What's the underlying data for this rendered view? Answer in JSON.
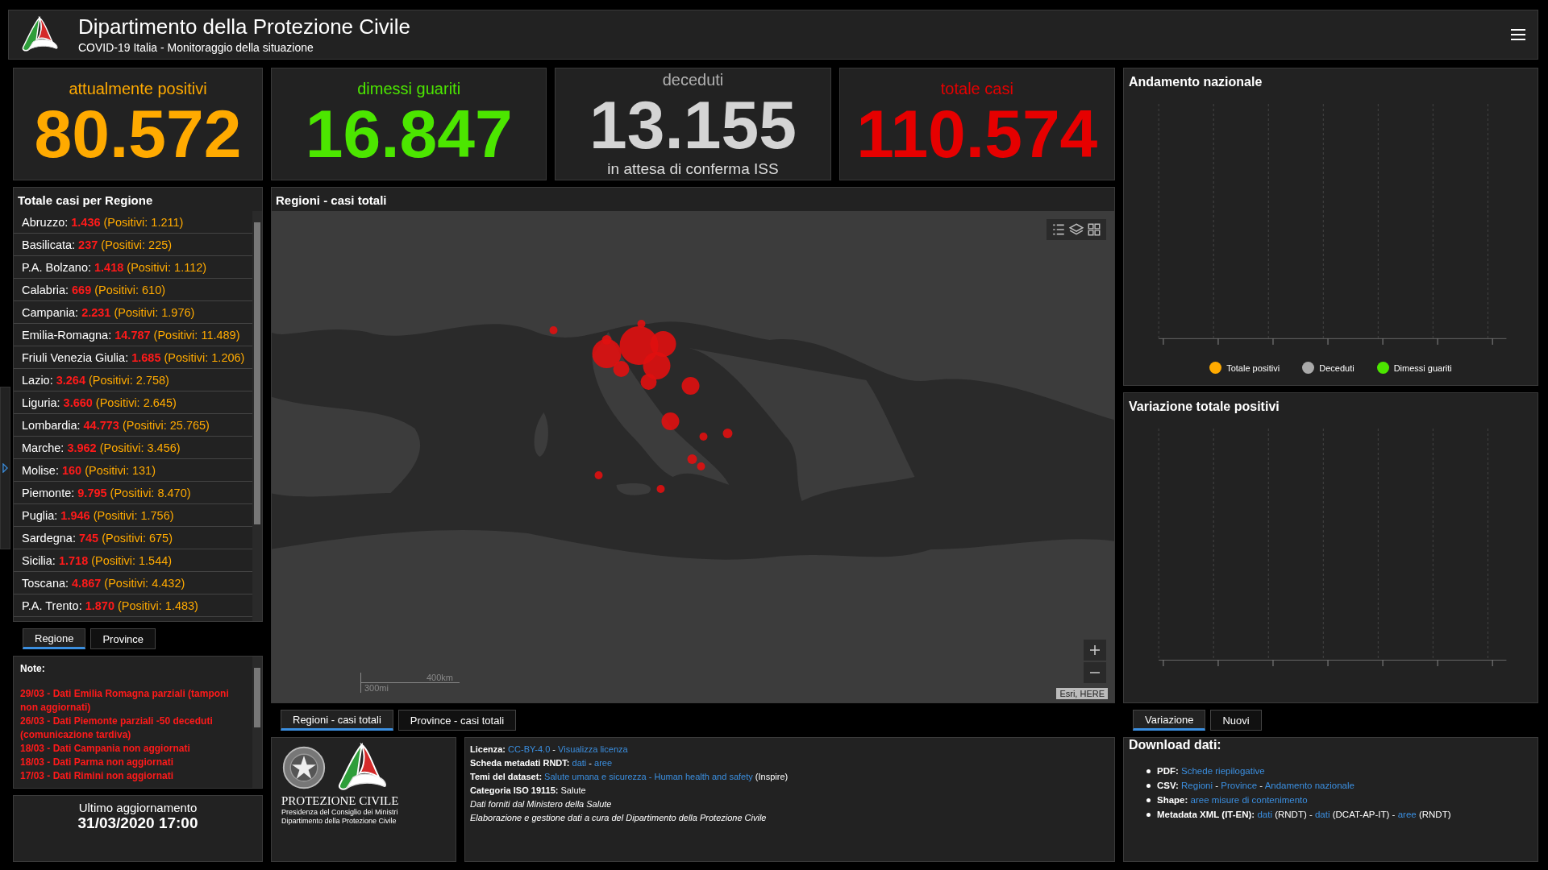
{
  "header": {
    "title": "Dipartimento della Protezione Civile",
    "subtitle": "COVID-19 Italia - Monitoraggio della situazione"
  },
  "kpis": [
    {
      "label": "attualmente positivi",
      "value": "80.572",
      "color": "#ffaa00"
    },
    {
      "label": "dimessi guariti",
      "value": "16.847",
      "color": "#4ce600"
    },
    {
      "label": "deceduti",
      "value": "13.155",
      "note": "in attesa di conferma ISS",
      "color": "#d4d4d4"
    },
    {
      "label": "totale casi",
      "value": "110.574",
      "color": "#e60000"
    }
  ],
  "regions_panel": {
    "title": "Totale casi per Regione",
    "rows": [
      {
        "name": "Abruzzo:",
        "total": "1.436",
        "positivi": "(Positivi: 1.211)"
      },
      {
        "name": "Basilicata:",
        "total": "237",
        "positivi": "(Positivi: 225)"
      },
      {
        "name": "P.A. Bolzano:",
        "total": "1.418",
        "positivi": "(Positivi: 1.112)"
      },
      {
        "name": "Calabria:",
        "total": "669",
        "positivi": "(Positivi: 610)"
      },
      {
        "name": "Campania:",
        "total": "2.231",
        "positivi": "(Positivi: 1.976)"
      },
      {
        "name": "Emilia-Romagna:",
        "total": "14.787",
        "positivi": "(Positivi: 11.489)"
      },
      {
        "name": "Friuli Venezia Giulia:",
        "total": "1.685",
        "positivi": "(Positivi: 1.206)"
      },
      {
        "name": "Lazio:",
        "total": "3.264",
        "positivi": "(Positivi: 2.758)"
      },
      {
        "name": "Liguria:",
        "total": "3.660",
        "positivi": "(Positivi: 2.645)"
      },
      {
        "name": "Lombardia:",
        "total": "44.773",
        "positivi": "(Positivi: 25.765)"
      },
      {
        "name": "Marche:",
        "total": "3.962",
        "positivi": "(Positivi: 3.456)"
      },
      {
        "name": "Molise:",
        "total": "160",
        "positivi": "(Positivi: 131)"
      },
      {
        "name": "Piemonte:",
        "total": "9.795",
        "positivi": "(Positivi: 8.470)"
      },
      {
        "name": "Puglia:",
        "total": "1.946",
        "positivi": "(Positivi: 1.756)"
      },
      {
        "name": "Sardegna:",
        "total": "745",
        "positivi": "(Positivi: 675)"
      },
      {
        "name": "Sicilia:",
        "total": "1.718",
        "positivi": "(Positivi: 1.544)"
      },
      {
        "name": "Toscana:",
        "total": "4.867",
        "positivi": "(Positivi: 4.432)"
      },
      {
        "name": "P.A. Trento:",
        "total": "1.870",
        "positivi": "(Positivi: 1.483)"
      }
    ]
  },
  "region_tabs": [
    {
      "label": "Regione",
      "selected": true
    },
    {
      "label": "Province",
      "selected": false
    }
  ],
  "notes": {
    "title": "Note:",
    "items": [
      "29/03 - Dati  Emilia Romagna parziali (tamponi non aggiornati)",
      "26/03 - Dati Piemonte parziali -50 deceduti (comunicazione tardiva)",
      "18/03 - Dati Campania non aggiornati",
      "18/03 - Dati Parma non aggiornati",
      "17/03 - Dati Rimini non aggiornati"
    ]
  },
  "last_update": {
    "label": "Ultimo aggiornamento",
    "value": "31/03/2020 17:00"
  },
  "map": {
    "title": "Regioni - casi totali",
    "scale_km": "400km",
    "scale_mi": "300mi",
    "attribution": "Esri, HERE",
    "tabs": [
      {
        "label": "Regioni - casi totali",
        "selected": true
      },
      {
        "label": "Province - casi totali",
        "selected": false
      }
    ]
  },
  "charts": [
    {
      "title": "Andamento nazionale",
      "legend": [
        {
          "label": "Totale positivi",
          "color": "#ffaa00"
        },
        {
          "label": "Deceduti",
          "color": "#aaaaaa"
        },
        {
          "label": "Dimessi guariti",
          "color": "#4ce600"
        }
      ]
    },
    {
      "title": "Variazione totale positivi"
    }
  ],
  "chart_tabs": [
    {
      "label": "Variazione",
      "selected": true
    },
    {
      "label": "Nuovi",
      "selected": false
    }
  ],
  "footer_logo": {
    "name": "PROTEZIONE CIVILE",
    "lines": [
      "Presidenza del Consiglio dei Ministri",
      "Dipartimento della Protezione Civile"
    ]
  },
  "info": [
    {
      "kind": "field",
      "parts": [
        {
          "kind": "label",
          "text": "Licenza:"
        },
        {
          "kind": "link",
          "text": "CC-BY-4.0"
        },
        {
          "kind": "text",
          "text": "-"
        },
        {
          "kind": "link",
          "text": "Visualizza licenza"
        }
      ]
    },
    {
      "kind": "field",
      "parts": [
        {
          "kind": "label",
          "text": "Scheda metadati RNDT:"
        },
        {
          "kind": "link",
          "text": "dati"
        },
        {
          "kind": "text",
          "text": "-"
        },
        {
          "kind": "link",
          "text": "aree"
        }
      ]
    },
    {
      "kind": "field",
      "parts": [
        {
          "kind": "label",
          "text": "Temi del dataset:"
        },
        {
          "kind": "link",
          "text": "Salute umana e sicurezza - Human health and safety"
        },
        {
          "kind": "text",
          "text": "(Inspire)"
        }
      ]
    },
    {
      "kind": "field",
      "parts": [
        {
          "kind": "label",
          "text": "Categoria ISO 19115:"
        },
        {
          "kind": "text",
          "text": "Salute"
        }
      ]
    },
    {
      "kind": "note",
      "parts": [
        {
          "kind": "text",
          "text": "Dati forniti dal Ministero della Salute"
        }
      ]
    },
    {
      "kind": "note",
      "parts": [
        {
          "kind": "text",
          "text": "Elaborazione e gestione dati a cura del Dipartimento della Protezione Civile"
        }
      ]
    }
  ],
  "downloads": {
    "title": "Download dati:",
    "items": [
      {
        "parts": [
          {
            "kind": "label",
            "text": "PDF:"
          },
          {
            "kind": "link",
            "text": "Schede riepilogative"
          }
        ]
      },
      {
        "parts": [
          {
            "kind": "label",
            "text": "CSV:"
          },
          {
            "kind": "link",
            "text": "Regioni"
          },
          {
            "kind": "text",
            "text": "-"
          },
          {
            "kind": "link",
            "text": "Province"
          },
          {
            "kind": "text",
            "text": "-"
          },
          {
            "kind": "link",
            "text": "Andamento nazionale"
          }
        ]
      },
      {
        "parts": [
          {
            "kind": "label",
            "text": "Shape:"
          },
          {
            "kind": "link",
            "text": "aree misure di contenimento"
          }
        ]
      },
      {
        "parts": [
          {
            "kind": "label",
            "text": "Metadata XML (IT-EN):"
          },
          {
            "kind": "link",
            "text": "dati"
          },
          {
            "kind": "text",
            "text": "(RNDT) -"
          },
          {
            "kind": "link",
            "text": "dati"
          },
          {
            "kind": "text",
            "text": "(DCAT-AP-IT) -"
          },
          {
            "kind": "link",
            "text": "aree"
          },
          {
            "kind": "text",
            "text": "(RNDT)"
          }
        ]
      }
    ]
  }
}
